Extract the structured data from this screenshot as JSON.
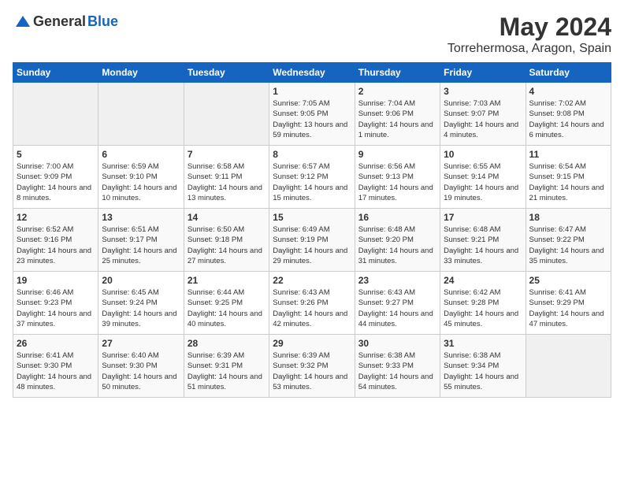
{
  "logo": {
    "general": "General",
    "blue": "Blue"
  },
  "title": "May 2024",
  "location": "Torrehermosa, Aragon, Spain",
  "days_of_week": [
    "Sunday",
    "Monday",
    "Tuesday",
    "Wednesday",
    "Thursday",
    "Friday",
    "Saturday"
  ],
  "weeks": [
    [
      {
        "day": "",
        "sunrise": "",
        "sunset": "",
        "daylight": ""
      },
      {
        "day": "",
        "sunrise": "",
        "sunset": "",
        "daylight": ""
      },
      {
        "day": "",
        "sunrise": "",
        "sunset": "",
        "daylight": ""
      },
      {
        "day": "1",
        "sunrise": "Sunrise: 7:05 AM",
        "sunset": "Sunset: 9:05 PM",
        "daylight": "Daylight: 13 hours and 59 minutes."
      },
      {
        "day": "2",
        "sunrise": "Sunrise: 7:04 AM",
        "sunset": "Sunset: 9:06 PM",
        "daylight": "Daylight: 14 hours and 1 minute."
      },
      {
        "day": "3",
        "sunrise": "Sunrise: 7:03 AM",
        "sunset": "Sunset: 9:07 PM",
        "daylight": "Daylight: 14 hours and 4 minutes."
      },
      {
        "day": "4",
        "sunrise": "Sunrise: 7:02 AM",
        "sunset": "Sunset: 9:08 PM",
        "daylight": "Daylight: 14 hours and 6 minutes."
      }
    ],
    [
      {
        "day": "5",
        "sunrise": "Sunrise: 7:00 AM",
        "sunset": "Sunset: 9:09 PM",
        "daylight": "Daylight: 14 hours and 8 minutes."
      },
      {
        "day": "6",
        "sunrise": "Sunrise: 6:59 AM",
        "sunset": "Sunset: 9:10 PM",
        "daylight": "Daylight: 14 hours and 10 minutes."
      },
      {
        "day": "7",
        "sunrise": "Sunrise: 6:58 AM",
        "sunset": "Sunset: 9:11 PM",
        "daylight": "Daylight: 14 hours and 13 minutes."
      },
      {
        "day": "8",
        "sunrise": "Sunrise: 6:57 AM",
        "sunset": "Sunset: 9:12 PM",
        "daylight": "Daylight: 14 hours and 15 minutes."
      },
      {
        "day": "9",
        "sunrise": "Sunrise: 6:56 AM",
        "sunset": "Sunset: 9:13 PM",
        "daylight": "Daylight: 14 hours and 17 minutes."
      },
      {
        "day": "10",
        "sunrise": "Sunrise: 6:55 AM",
        "sunset": "Sunset: 9:14 PM",
        "daylight": "Daylight: 14 hours and 19 minutes."
      },
      {
        "day": "11",
        "sunrise": "Sunrise: 6:54 AM",
        "sunset": "Sunset: 9:15 PM",
        "daylight": "Daylight: 14 hours and 21 minutes."
      }
    ],
    [
      {
        "day": "12",
        "sunrise": "Sunrise: 6:52 AM",
        "sunset": "Sunset: 9:16 PM",
        "daylight": "Daylight: 14 hours and 23 minutes."
      },
      {
        "day": "13",
        "sunrise": "Sunrise: 6:51 AM",
        "sunset": "Sunset: 9:17 PM",
        "daylight": "Daylight: 14 hours and 25 minutes."
      },
      {
        "day": "14",
        "sunrise": "Sunrise: 6:50 AM",
        "sunset": "Sunset: 9:18 PM",
        "daylight": "Daylight: 14 hours and 27 minutes."
      },
      {
        "day": "15",
        "sunrise": "Sunrise: 6:49 AM",
        "sunset": "Sunset: 9:19 PM",
        "daylight": "Daylight: 14 hours and 29 minutes."
      },
      {
        "day": "16",
        "sunrise": "Sunrise: 6:48 AM",
        "sunset": "Sunset: 9:20 PM",
        "daylight": "Daylight: 14 hours and 31 minutes."
      },
      {
        "day": "17",
        "sunrise": "Sunrise: 6:48 AM",
        "sunset": "Sunset: 9:21 PM",
        "daylight": "Daylight: 14 hours and 33 minutes."
      },
      {
        "day": "18",
        "sunrise": "Sunrise: 6:47 AM",
        "sunset": "Sunset: 9:22 PM",
        "daylight": "Daylight: 14 hours and 35 minutes."
      }
    ],
    [
      {
        "day": "19",
        "sunrise": "Sunrise: 6:46 AM",
        "sunset": "Sunset: 9:23 PM",
        "daylight": "Daylight: 14 hours and 37 minutes."
      },
      {
        "day": "20",
        "sunrise": "Sunrise: 6:45 AM",
        "sunset": "Sunset: 9:24 PM",
        "daylight": "Daylight: 14 hours and 39 minutes."
      },
      {
        "day": "21",
        "sunrise": "Sunrise: 6:44 AM",
        "sunset": "Sunset: 9:25 PM",
        "daylight": "Daylight: 14 hours and 40 minutes."
      },
      {
        "day": "22",
        "sunrise": "Sunrise: 6:43 AM",
        "sunset": "Sunset: 9:26 PM",
        "daylight": "Daylight: 14 hours and 42 minutes."
      },
      {
        "day": "23",
        "sunrise": "Sunrise: 6:43 AM",
        "sunset": "Sunset: 9:27 PM",
        "daylight": "Daylight: 14 hours and 44 minutes."
      },
      {
        "day": "24",
        "sunrise": "Sunrise: 6:42 AM",
        "sunset": "Sunset: 9:28 PM",
        "daylight": "Daylight: 14 hours and 45 minutes."
      },
      {
        "day": "25",
        "sunrise": "Sunrise: 6:41 AM",
        "sunset": "Sunset: 9:29 PM",
        "daylight": "Daylight: 14 hours and 47 minutes."
      }
    ],
    [
      {
        "day": "26",
        "sunrise": "Sunrise: 6:41 AM",
        "sunset": "Sunset: 9:30 PM",
        "daylight": "Daylight: 14 hours and 48 minutes."
      },
      {
        "day": "27",
        "sunrise": "Sunrise: 6:40 AM",
        "sunset": "Sunset: 9:30 PM",
        "daylight": "Daylight: 14 hours and 50 minutes."
      },
      {
        "day": "28",
        "sunrise": "Sunrise: 6:39 AM",
        "sunset": "Sunset: 9:31 PM",
        "daylight": "Daylight: 14 hours and 51 minutes."
      },
      {
        "day": "29",
        "sunrise": "Sunrise: 6:39 AM",
        "sunset": "Sunset: 9:32 PM",
        "daylight": "Daylight: 14 hours and 53 minutes."
      },
      {
        "day": "30",
        "sunrise": "Sunrise: 6:38 AM",
        "sunset": "Sunset: 9:33 PM",
        "daylight": "Daylight: 14 hours and 54 minutes."
      },
      {
        "day": "31",
        "sunrise": "Sunrise: 6:38 AM",
        "sunset": "Sunset: 9:34 PM",
        "daylight": "Daylight: 14 hours and 55 minutes."
      },
      {
        "day": "",
        "sunrise": "",
        "sunset": "",
        "daylight": ""
      }
    ]
  ]
}
